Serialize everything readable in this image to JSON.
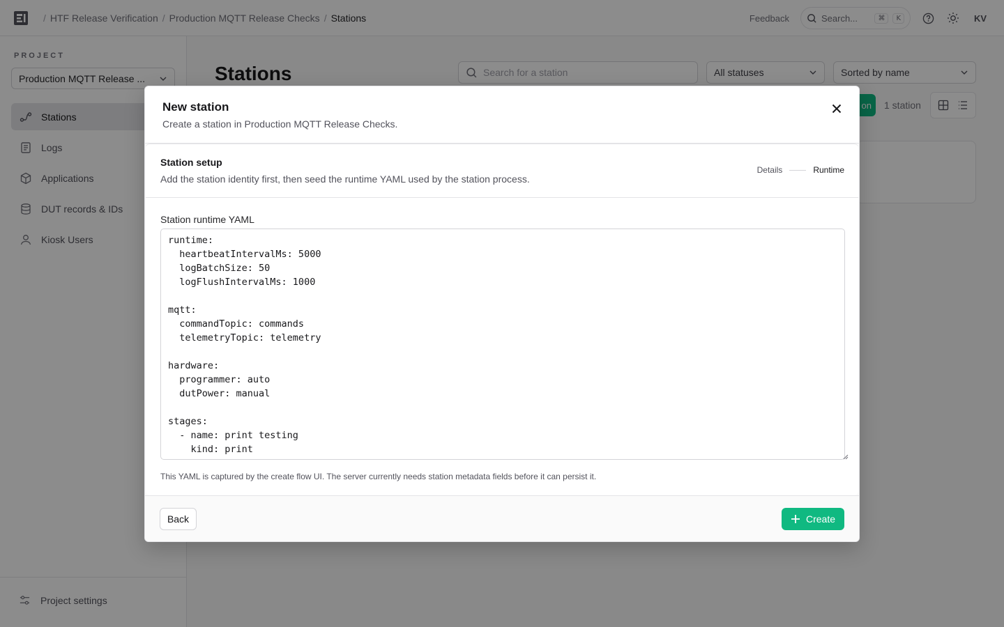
{
  "topbar": {
    "breadcrumbs": [
      "HTF Release Verification",
      "Production MQTT Release Checks",
      "Stations"
    ],
    "feedback_label": "Feedback",
    "search_placeholder": "Search...",
    "kbd_cmd": "⌘",
    "kbd_k": "K",
    "avatar_initials": "KV"
  },
  "sidebar": {
    "project_label": "PROJECT",
    "project_name": "Production MQTT Release ...",
    "items": [
      {
        "label": "Stations",
        "icon": "stations-icon",
        "active": true
      },
      {
        "label": "Logs",
        "icon": "logs-icon"
      },
      {
        "label": "Applications",
        "icon": "box-icon"
      },
      {
        "label": "DUT records & IDs",
        "icon": "database-icon"
      },
      {
        "label": "Kiosk Users",
        "icon": "user-icon"
      }
    ],
    "settings_label": "Project settings"
  },
  "main": {
    "title": "Stations",
    "search_placeholder": "Search for a station",
    "status_filter": "All statuses",
    "sort_filter": "Sorted by name",
    "new_button_fragment": "on",
    "count_label": "1 station"
  },
  "modal": {
    "title": "New station",
    "subtitle": "Create a station in Production MQTT Release Checks.",
    "setup_title": "Station setup",
    "setup_subtitle": "Add the station identity first, then seed the runtime YAML used by the station process.",
    "steps": [
      "Details",
      "Runtime"
    ],
    "field_label": "Station runtime YAML",
    "yaml": "runtime:\n  heartbeatIntervalMs: 5000\n  logBatchSize: 50\n  logFlushIntervalMs: 1000\n\nmqtt:\n  commandTopic: commands\n  telemetryTopic: telemetry\n\nhardware:\n  programmer: auto\n  dutPower: manual\n\nstages:\n  - name: print testing\n    kind: print\n    message: testing",
    "help_text": "This YAML is captured by the create flow UI. The server currently needs station metadata fields before it can persist it.",
    "back_label": "Back",
    "create_label": "Create"
  },
  "colors": {
    "accent": "#10b981",
    "overlay": "rgba(0,0,0,0.45)"
  }
}
